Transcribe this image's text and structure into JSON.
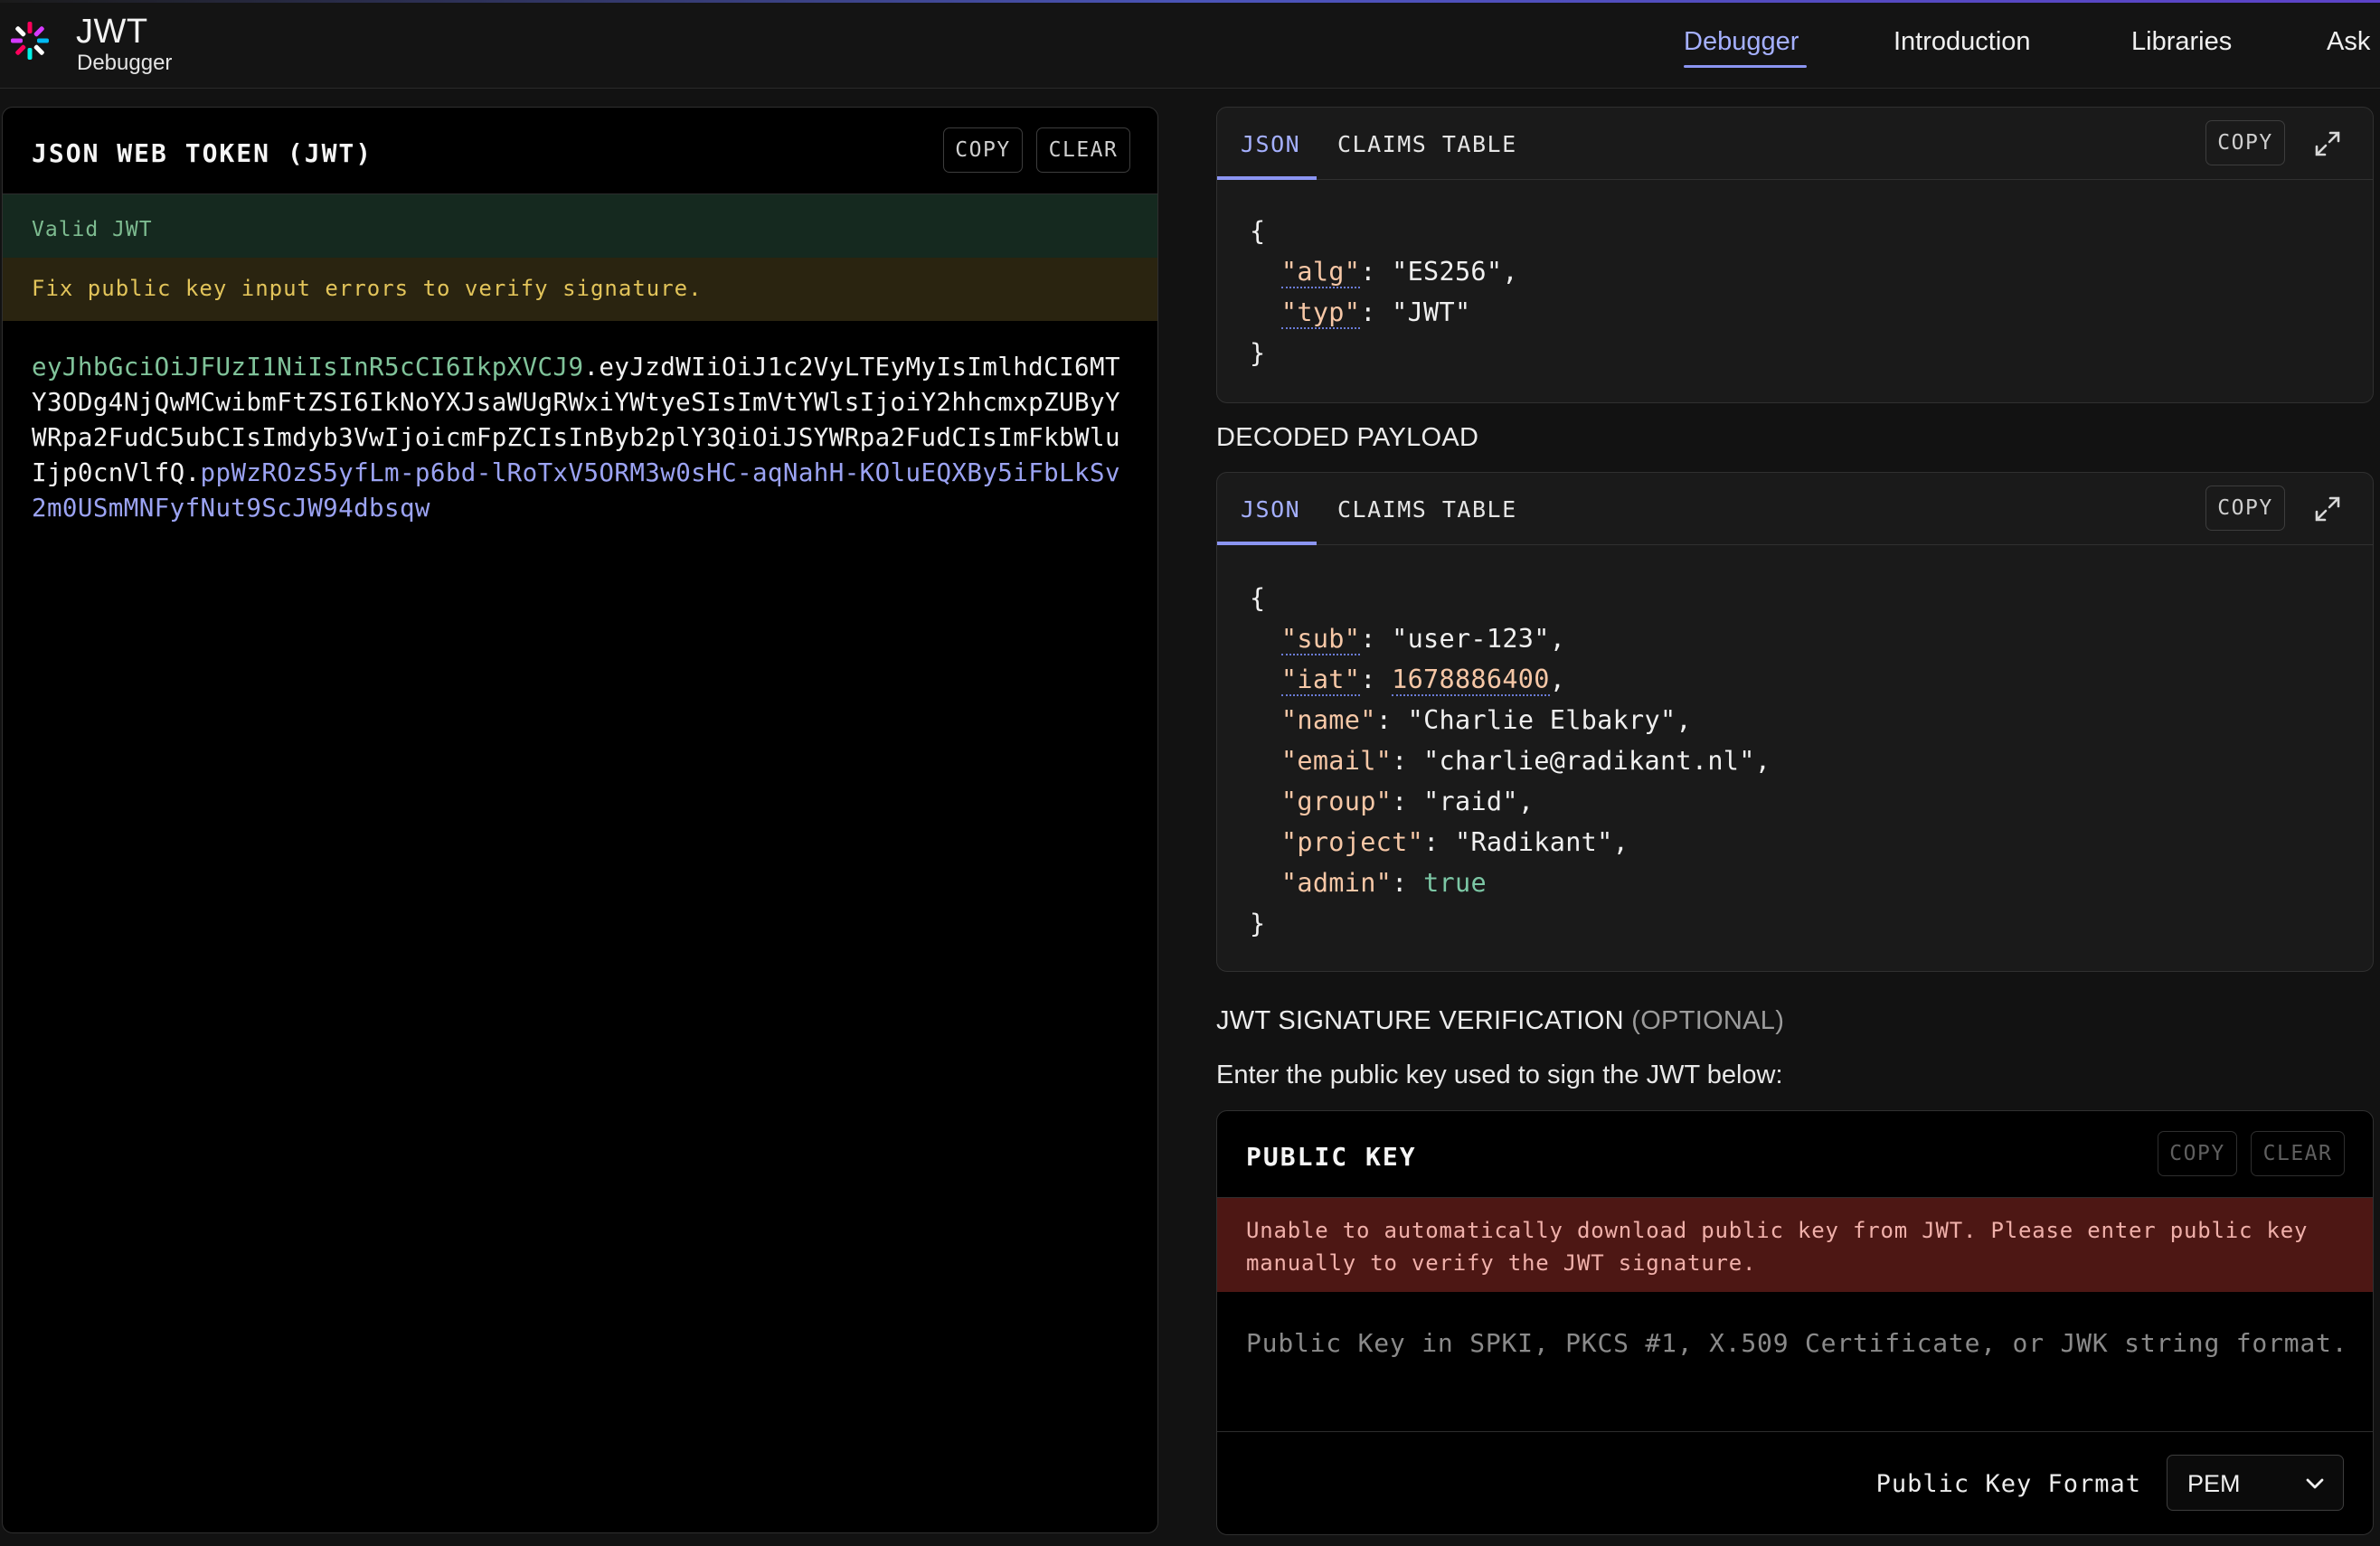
{
  "brand": {
    "title": "JWT",
    "subtitle": "Debugger"
  },
  "nav": {
    "items": [
      "Debugger",
      "Introduction",
      "Libraries",
      "Ask"
    ],
    "active": "Debugger"
  },
  "encoded": {
    "title": "JSON WEB TOKEN (JWT)",
    "copy_label": "COPY",
    "clear_label": "CLEAR",
    "status_valid": "Valid JWT",
    "status_warning": "Fix public key input errors to verify signature.",
    "token_header": "eyJhbGciOiJFUzI1NiIsInR5cCI6IkpXVCJ9",
    "token_payload": "eyJzdWIiOiJ1c2VyLTEyMyIsImlhdCI6MTY3ODg4NjQwMCwibmFtZSI6IkNoYXJsaWUgRWxiYWtyeSIsImVtYWlsIjoiY2hhcmxpZUByYWRpa2FudC5ubCIsImdyb3VwIjoicmFpZCIsInByb2plY3QiOiJSYWRpa2FudCIsImFkbWluIjp0cnVlfQ",
    "token_signature": "ppWzROzS5yfLm-p6bd-lRoTxV5ORM3w0sHC-aqNahH-KOluEQXBy5iFbLkSv2m0USmMNFyfNut9ScJW94dbsqw",
    "dot": "."
  },
  "decoded_header": {
    "tab_json": "JSON",
    "tab_claims": "CLAIMS TABLE",
    "copy_label": "COPY",
    "open_brace": "{",
    "close_brace": "}",
    "fields": [
      {
        "key": "\"alg\"",
        "value": "\"ES256\""
      },
      {
        "key": "\"typ\"",
        "value": "\"JWT\""
      }
    ]
  },
  "decoded_payload": {
    "title": "DECODED PAYLOAD",
    "tab_json": "JSON",
    "tab_claims": "CLAIMS TABLE",
    "copy_label": "COPY",
    "open_brace": "{",
    "close_brace": "}",
    "fields": [
      {
        "key": "\"sub\"",
        "value": "\"user-123\""
      },
      {
        "key": "\"iat\"",
        "value": "1678886400"
      },
      {
        "key": "\"name\"",
        "value": "\"Charlie Elbakry\""
      },
      {
        "key": "\"email\"",
        "value": "\"charlie@radikant.nl\""
      },
      {
        "key": "\"group\"",
        "value": "\"raid\""
      },
      {
        "key": "\"project\"",
        "value": "\"Radikant\""
      },
      {
        "key": "\"admin\"",
        "value": "true"
      }
    ]
  },
  "verification": {
    "title": "JWT SIGNATURE VERIFICATION",
    "optional": "(OPTIONAL)",
    "instructions": "Enter the public key used to sign the JWT below:",
    "panel_title": "PUBLIC KEY",
    "copy_label": "COPY",
    "clear_label": "CLEAR",
    "error_line1": "Unable to automatically download public key from JWT. Please enter public key",
    "error_line2": "manually to verify the JWT signature.",
    "placeholder": "Public Key in SPKI, PKCS #1, X.509 Certificate, or JWK string format.",
    "format_label": "Public Key Format",
    "format_value": "PEM"
  },
  "colors": {
    "accent": "#8b95f2",
    "header_segment": "#80c39a",
    "signature_segment": "#9ba3f3",
    "valid_bg": "#15291f",
    "warning_bg": "#2a2410",
    "error_bg": "#4d1714"
  }
}
